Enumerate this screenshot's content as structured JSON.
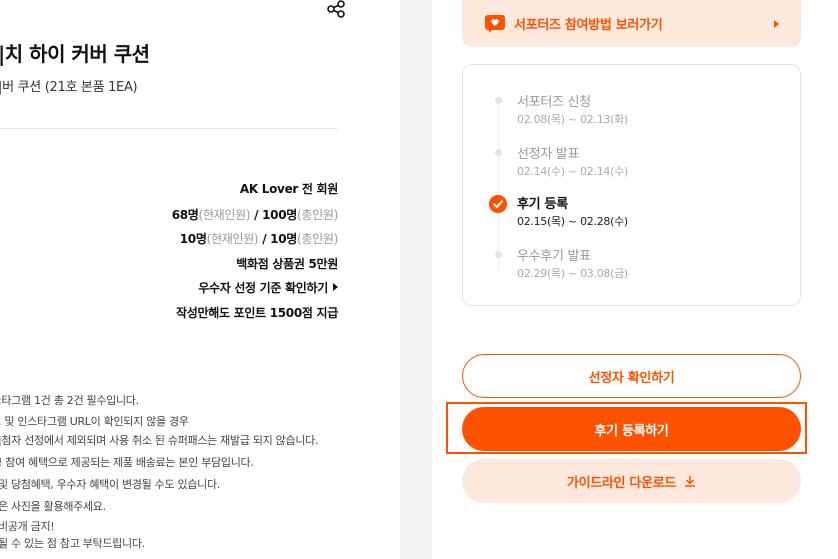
{
  "product": {
    "title": "|치 하이 커버 쿠션",
    "subtitle": "|버 쿠션 (21호 본품 1EA)"
  },
  "info": {
    "target": "AK Lover 전 회원",
    "recruit_main": "68명",
    "recruit_current_label": "(현재인원)",
    "recruit_sep": " / ",
    "recruit_total": "100명",
    "recruit_total_label": "(총인원)",
    "select_main": "10명",
    "select_current_label": "(현재인원)",
    "select_sep": " / ",
    "select_total": "10명",
    "select_total_label": "(총인원)",
    "reward": "백화점 상품권 5만원",
    "criteria_link": "우수자 선정 기준 확인하기",
    "point": "작성만해도 포인트 1500점 지급"
  },
  "notices": [
    ":타그램 1건 총 2건 필수입니다.",
    ". 및 인스타그램 URL이 확인되지 않을 경우",
    "|첨자 선정에서 제외되며 사용 취소 된 슈퍼패스는 재발급 되지 않습니다.",
    "! 참여 혜택으로 제공되는 제품 배송료는 본인 부담입니다.",
    "및 당첨혜택, 우수자 혜택이 변경될 수도 있습니다.",
    "은 사진을 활용해주세요.",
    " 비공개 금지!",
    "될 수 있는 점 참고 부탁드립니다."
  ],
  "guide_banner": {
    "label": "서포터즈 참여방법 보러가기"
  },
  "timeline": [
    {
      "name": "서포터즈 신청",
      "date": "02.08(목) ~ 02.13(화)",
      "active": false
    },
    {
      "name": "선정자 발표",
      "date": "02.14(수) ~ 02.14(수)",
      "active": false
    },
    {
      "name": "후기 등록",
      "date": "02.15(목) ~ 02.28(수)",
      "active": true
    },
    {
      "name": "우수후기 발표",
      "date": "02.29(목) ~ 03.08(금)",
      "active": false
    }
  ],
  "buttons": {
    "check_selected": "선정자 확인하기",
    "register_review": "후기 등록하기",
    "download_guide": "가이드라인 다운로드"
  },
  "colors": {
    "accent": "#ff5200",
    "accent_soft": "#fde8de"
  }
}
